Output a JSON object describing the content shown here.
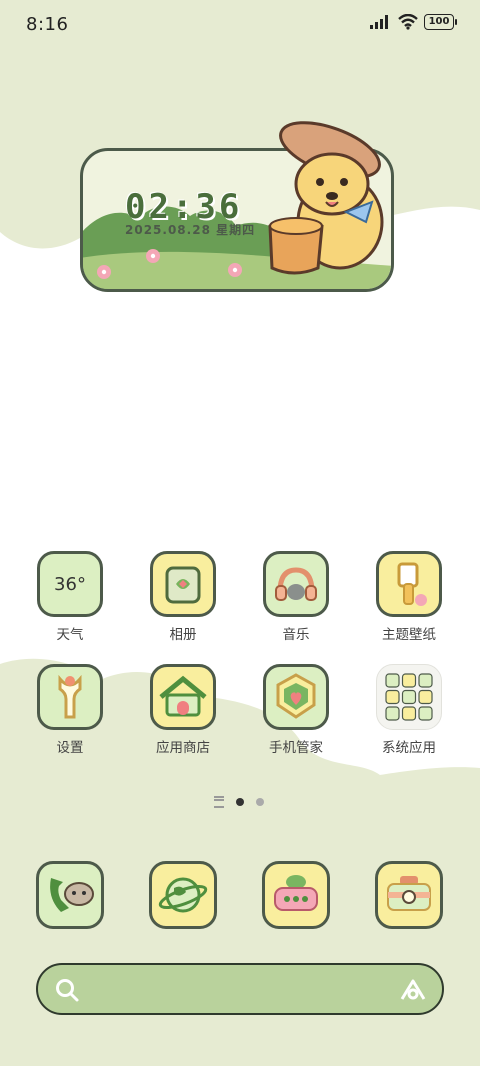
{
  "status_bar": {
    "time": "8:16",
    "battery": "100",
    "signal_icon": "cellular-signal-icon",
    "wifi_icon": "wifi-icon"
  },
  "widget": {
    "clock": "02:36",
    "date": "2025.08.28  星期四"
  },
  "apps": [
    {
      "label": "天气",
      "icon": "weather-icon",
      "text": "36°"
    },
    {
      "label": "相册",
      "icon": "gallery-icon"
    },
    {
      "label": "音乐",
      "icon": "music-icon"
    },
    {
      "label": "主题壁纸",
      "icon": "themes-icon"
    },
    {
      "label": "设置",
      "icon": "settings-icon"
    },
    {
      "label": "应用商店",
      "icon": "app-store-icon"
    },
    {
      "label": "手机管家",
      "icon": "security-icon"
    },
    {
      "label": "系统应用",
      "icon": "system-apps-folder-icon"
    }
  ],
  "dock": [
    {
      "icon": "phone-icon"
    },
    {
      "icon": "browser-icon"
    },
    {
      "icon": "messages-icon"
    },
    {
      "icon": "camera-icon"
    }
  ],
  "colors": {
    "accent_green": "#b9d29c",
    "icon_bg_yellow": "#f9ee9e",
    "icon_bg_green": "#dcefc2",
    "outline": "#4d5a4a"
  }
}
